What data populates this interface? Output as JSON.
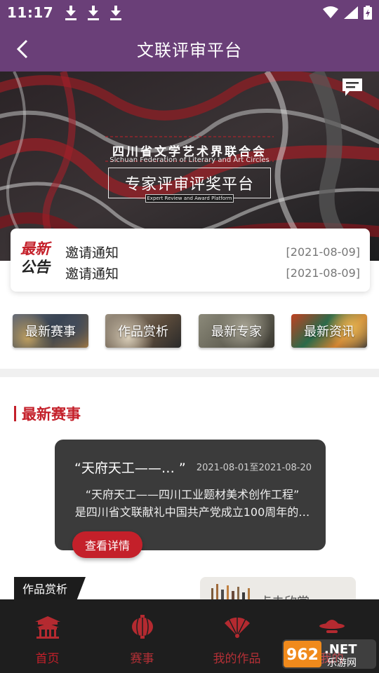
{
  "status_bar": {
    "time": "11:17"
  },
  "app_bar": {
    "title": "文联评审平台"
  },
  "banner": {
    "org_name": "四川省文学艺术界联合会",
    "org_name_en": "Sichuan Federation of Literary and Art Circles",
    "platform_name": "专家评审评奖平台",
    "platform_name_en": "Expert Review and Award Platform"
  },
  "notice": {
    "badge_top": "最新",
    "badge_bottom": "公告",
    "items": [
      {
        "title": "邀请通知",
        "date": "[2021-08-09]"
      },
      {
        "title": "邀请通知",
        "date": "[2021-08-09]"
      }
    ]
  },
  "categories": [
    {
      "label": "最新赛事"
    },
    {
      "label": "作品赏析"
    },
    {
      "label": "最新专家"
    },
    {
      "label": "最新资讯"
    }
  ],
  "latest_events": {
    "section_title": "最新赛事",
    "event": {
      "name": "“天府天工——… ”",
      "date_range": "2021-08-01至2021-08-20",
      "desc_line1": "“天府天工——四川工业题材美术创作工程”",
      "desc_line2": "是四川省文联献礼中国共产党成立100周年的…"
    },
    "detail_button": "查看详情"
  },
  "works": {
    "tag": "作品赏析",
    "card_label": "点击欣赏"
  },
  "bottom_nav": [
    {
      "label": "首页",
      "icon": "home-pavilion-icon"
    },
    {
      "label": "赛事",
      "icon": "lantern-icon"
    },
    {
      "label": "我的作品",
      "icon": "fan-icon"
    },
    {
      "label": "我的",
      "icon": "hat-icon"
    }
  ],
  "watermark": {
    "top": "962.NET",
    "bottom": "乐游网"
  }
}
